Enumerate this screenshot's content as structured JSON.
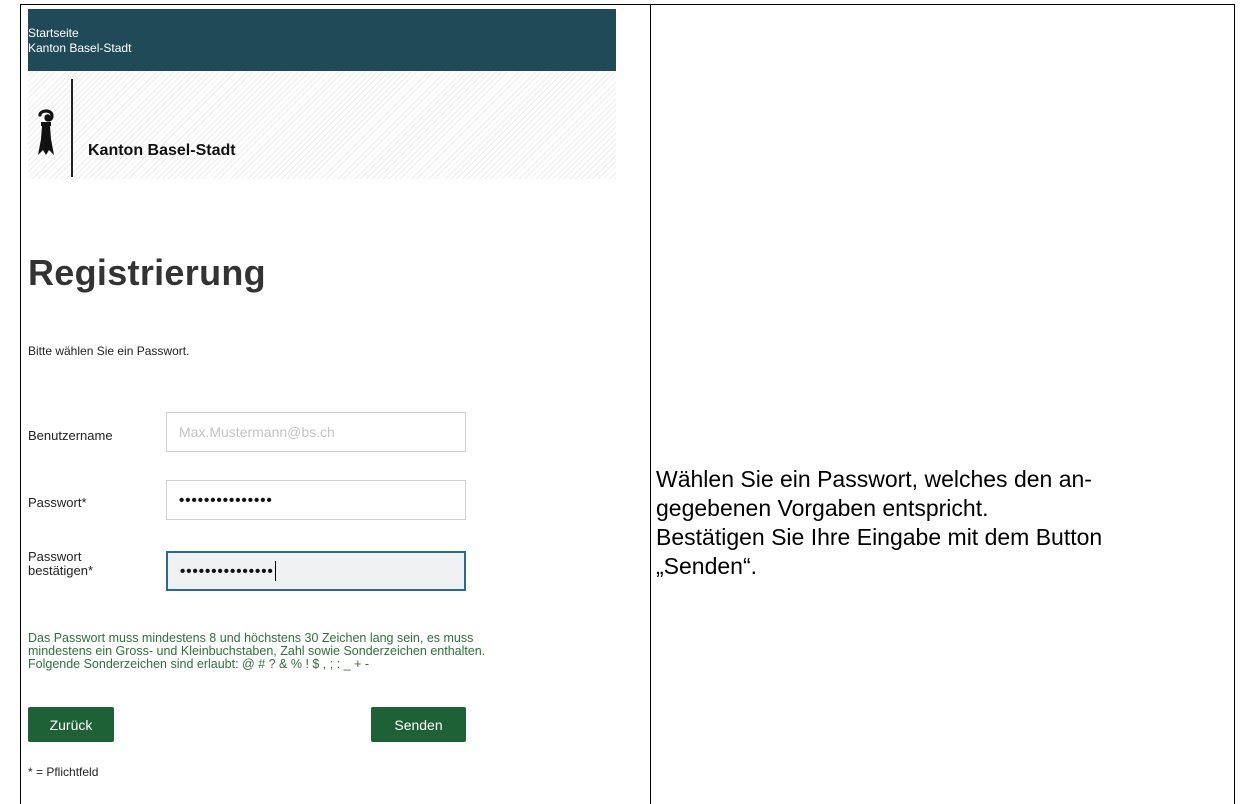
{
  "topbar": {
    "link_home": "Startseite",
    "link_canton": "Kanton Basel-Stadt"
  },
  "header": {
    "brand_name": "Kanton Basel-Stadt",
    "logo_icon": "baselstab-icon"
  },
  "form": {
    "title": "Registrierung",
    "intro": "Bitte wählen Sie ein Passwort.",
    "username_label": "Benutzername",
    "username_value": "Max.Mustermann@bs.ch",
    "password_label": "Passwort*",
    "password_value": "•••••••••••••••",
    "password_confirm_label_1": "Passwort",
    "password_confirm_label_2": "bestätigen*",
    "password_confirm_value": "•••••••••••••••",
    "hint_lines": [
      "Das Passwort muss mindestens 8 und höchstens 30 Zeichen lang sein, es muss",
      "mindestens ein Gross- und Kleinbuchstaben, Zahl sowie Sonderzeichen enthalten.",
      "Folgende Sonderzeichen sind erlaubt: @ # ? & % ! $ , ; : _ + -"
    ],
    "back_label": "Zurück",
    "send_label": "Senden",
    "required_note": "* = Pflichtfeld"
  },
  "instructions": {
    "lines": [
      "Wählen Sie ein Passwort, welches den an-",
      "gegebenen Vorgaben entspricht.",
      "Bestätigen Sie Ihre Eingabe mit dem Button",
      "„Senden“."
    ]
  },
  "colors": {
    "topbar": "#214a58",
    "button": "#1f6136",
    "hint_text": "#2f6f3c",
    "focus_border": "#2b6a90"
  }
}
